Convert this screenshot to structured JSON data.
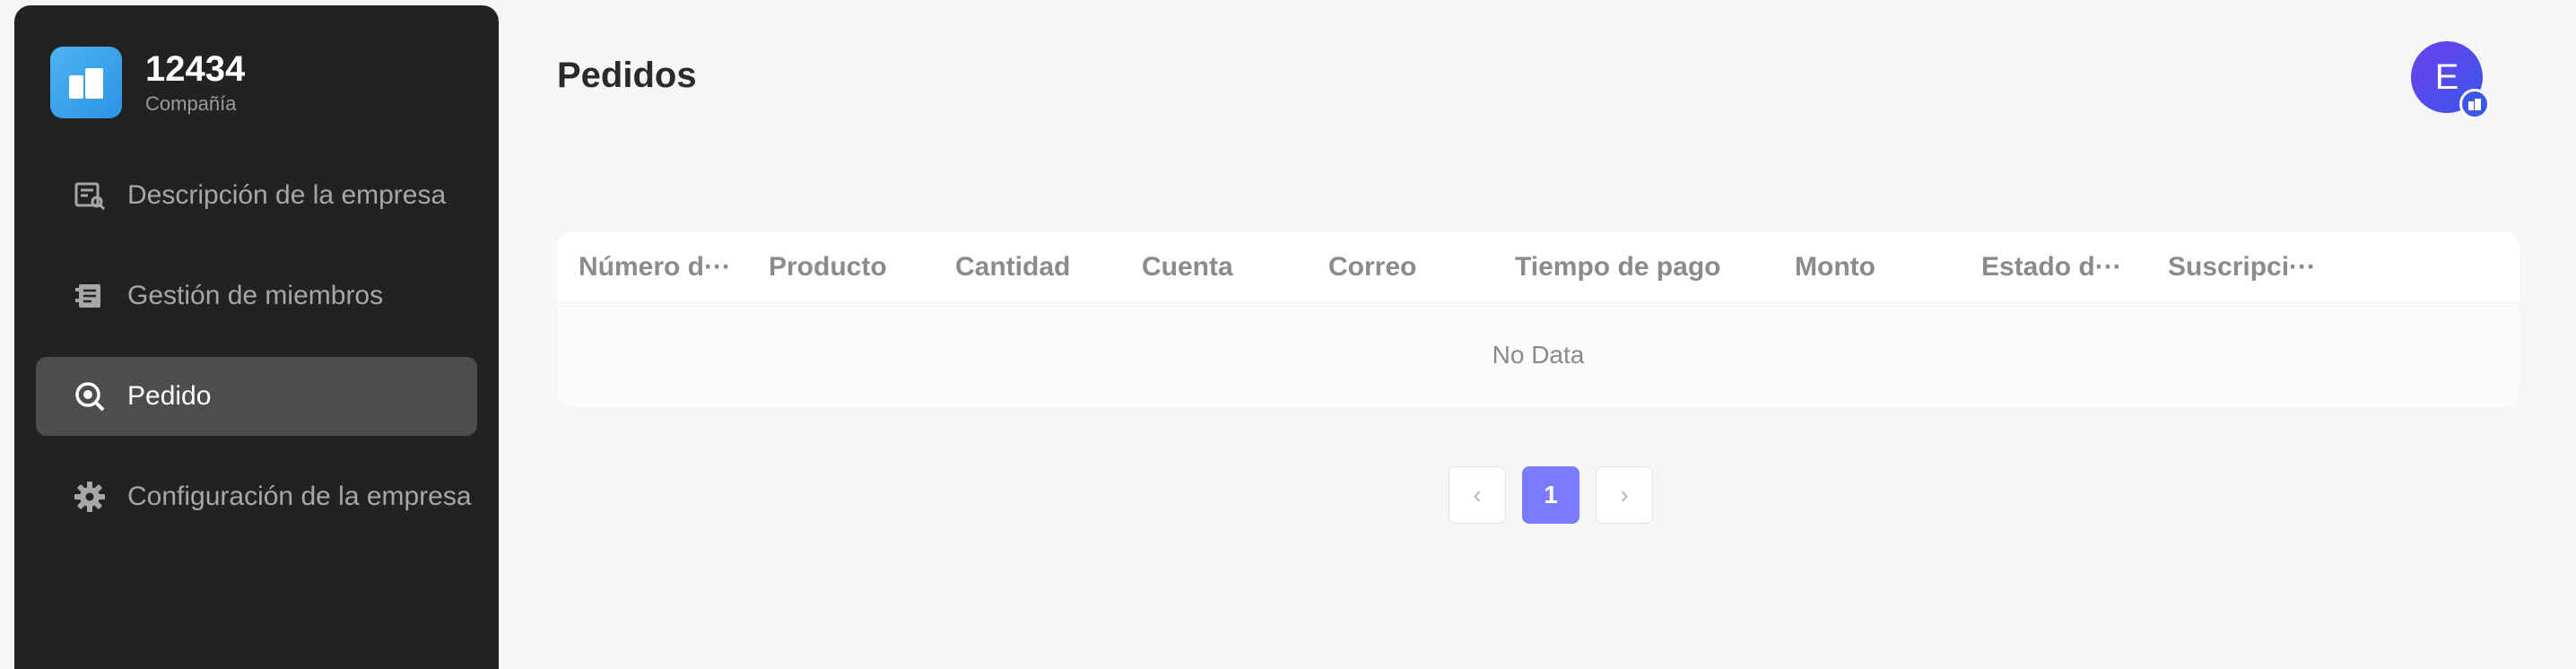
{
  "sidebar": {
    "brand": {
      "name": "12434",
      "subtitle": "Compañía"
    },
    "items": [
      {
        "label": "Descripción de la empresa",
        "icon": "company-info-icon",
        "active": false
      },
      {
        "label": "Gestión de miembros",
        "icon": "members-icon",
        "active": false
      },
      {
        "label": "Pedido",
        "icon": "order-search-icon",
        "active": true
      },
      {
        "label": "Configuración de la empresa",
        "icon": "gear-icon",
        "active": false
      }
    ]
  },
  "header": {
    "title": "Pedidos",
    "avatar_initial": "E"
  },
  "table": {
    "columns": [
      "Número d···",
      "Producto",
      "Cantidad",
      "Cuenta",
      "Correo",
      "Tiempo de pago",
      "Monto",
      "Estado d···",
      "Suscripci···"
    ],
    "empty_text": "No Data"
  },
  "pagination": {
    "prev_symbol": "‹",
    "current_page": "1",
    "next_symbol": "›"
  },
  "colors": {
    "sidebar_bg": "#222222",
    "active_item_bg": "#4d4d4d",
    "accent": "#7b7bff",
    "avatar": "#4f4cec",
    "brand_logo": "#3aa4ee"
  }
}
